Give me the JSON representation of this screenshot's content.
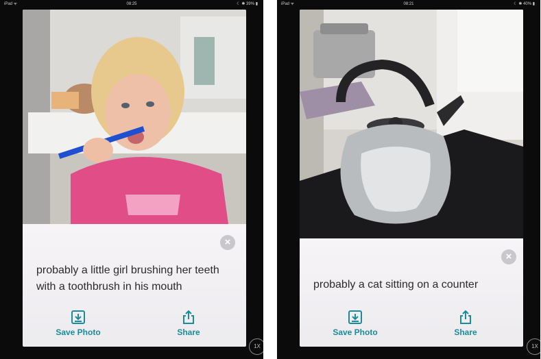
{
  "screens": [
    {
      "status": {
        "left": "iPad ᯤ",
        "time": "08:25",
        "right": "☾ ✱ 39% ▮"
      },
      "caption": "probably a little girl brushing her teeth with a toothbrush in his mouth",
      "save_label": "Save Photo",
      "share_label": "Share",
      "zoom_label": "1X",
      "close_glyph": "×",
      "photo_icon": "photo-girl-brushing-teeth"
    },
    {
      "status": {
        "left": "iPad ᯤ",
        "time": "08:21",
        "right": "☾ ✱ 40% ▮"
      },
      "caption": "probably a cat sitting on a counter",
      "save_label": "Save Photo",
      "share_label": "Share",
      "zoom_label": "1X",
      "close_glyph": "×",
      "photo_icon": "photo-kettle-on-stove"
    }
  ],
  "colors": {
    "accent": "#1b8a9a",
    "panel": "#efedf0",
    "screen_bezel": "#0b0b0b"
  }
}
